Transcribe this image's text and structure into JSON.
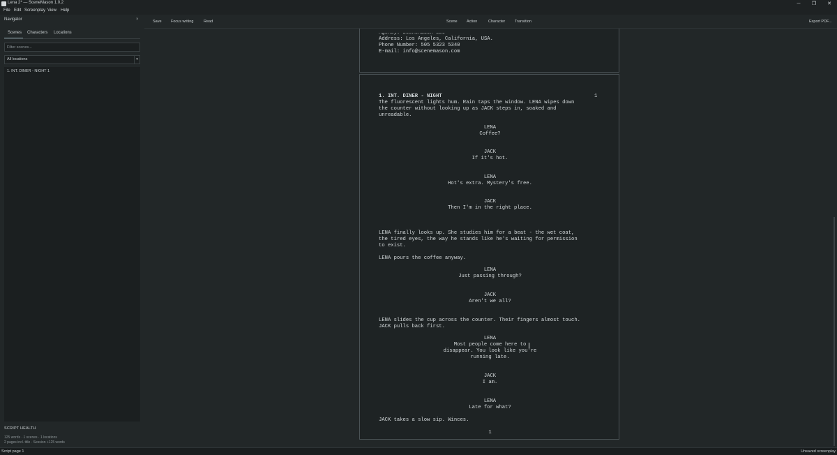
{
  "window": {
    "title": "Lena 2* — SceneMason 1.0.2",
    "minimize": "─",
    "maximize": "❐",
    "close": "✕"
  },
  "menu": [
    "File",
    "Edit",
    "Screenplay",
    "View",
    "Help"
  ],
  "navigator": {
    "title": "Navigator",
    "close": "×",
    "tabs": [
      "Scenes",
      "Characters",
      "Locations"
    ],
    "filter_placeholder": "Filter scenes...",
    "location_select": "All locations",
    "scenes": [
      "1. INT. DINER - NIGHT 1"
    ]
  },
  "health": {
    "title": "SCRIPT HEALTH",
    "line1": "125 words · 1 scenes · 1 locations",
    "line2": "2 pages incl. title · Session +125 words"
  },
  "toolbar": {
    "save": "Save",
    "focus": "Focus writing",
    "read": "Read",
    "scene": "Scene",
    "action": "Action",
    "character": "Character",
    "transition": "Transition",
    "export": "Export PDF..."
  },
  "title_page": {
    "partial": "Agency: SceneMason LLC",
    "address": "Address: Los Angeles, California, USA.",
    "phone": "Phone Number: 505 5323 5340",
    "email": "E-mail: info@scenemason.com"
  },
  "script": {
    "heading": "1. INT. DINER - NIGHT",
    "scene_number": "1",
    "action1": [
      "The fluorescent lights hum. Rain taps the window. LENA wipes down",
      "the counter without looking up as JACK steps in, soaked and",
      "unreadable."
    ],
    "c1": "LENA",
    "d1": "Coffee?",
    "c2": "JACK",
    "d2": "If it's hot.",
    "c3": "LENA",
    "d3": "Hot's extra. Mystery's free.",
    "c4": "JACK",
    "d4": "Then I'm in the right place.",
    "action2": [
      "LENA finally looks up. She studies him for a beat - the wet coat,",
      "the tired eyes, the way he stands like he's waiting for permission",
      "to exist."
    ],
    "action3": "LENA pours the coffee anyway.",
    "c5": "LENA",
    "d5": "Just passing through?",
    "c6": "JACK",
    "d6": "Aren't we all?",
    "action4": [
      "LENA slides the cup across the counter. Their fingers almost touch.",
      "JACK pulls back first."
    ],
    "c7": "LENA",
    "d7": [
      "Most people come here to",
      "disappear. You look like you're",
      "running late."
    ],
    "c8": "JACK",
    "d8": "I am.",
    "c9": "LENA",
    "d9": "Late for what?",
    "action5": "JACK takes a slow sip. Winces.",
    "page_number": "1"
  },
  "status": {
    "left": "Script page 1",
    "right": "Unsaved screenplay"
  }
}
